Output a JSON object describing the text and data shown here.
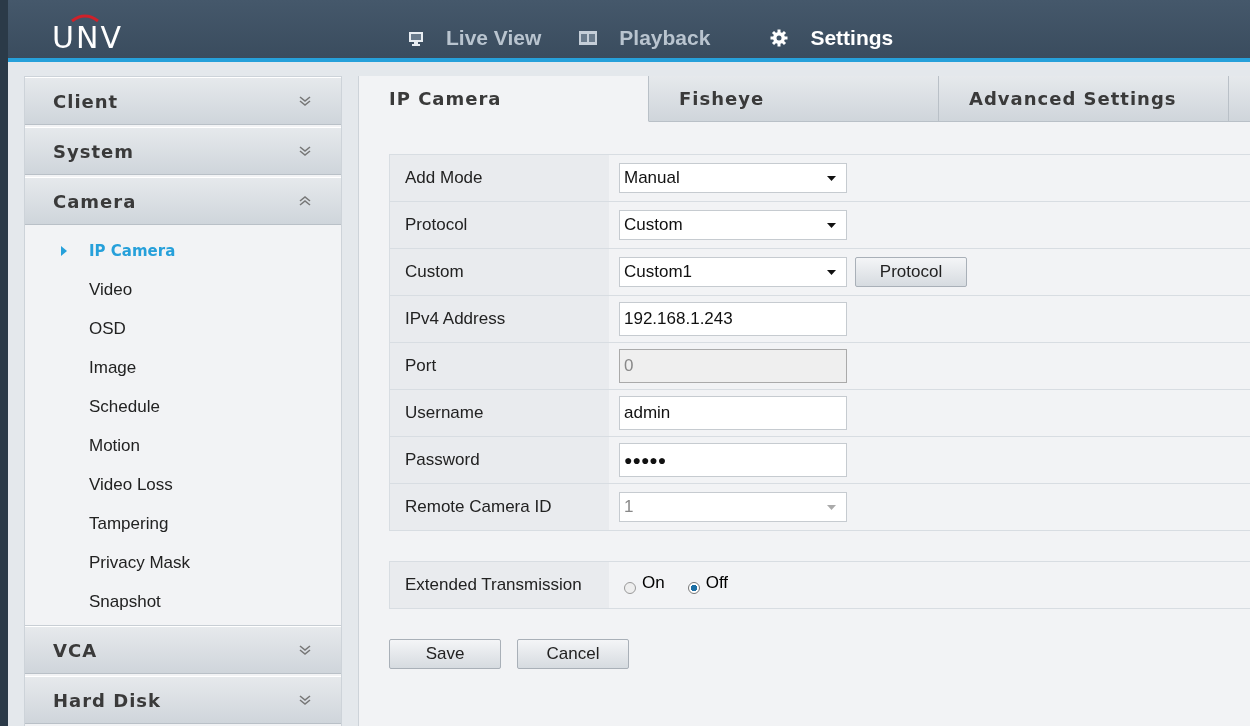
{
  "header": {
    "logo": "UNV",
    "nav": [
      {
        "label": "Live View",
        "selected": false
      },
      {
        "label": "Playback",
        "selected": false
      },
      {
        "label": "Settings",
        "selected": true
      }
    ]
  },
  "sidebar": {
    "groups": [
      {
        "label": "Client",
        "expanded": false
      },
      {
        "label": "System",
        "expanded": false
      },
      {
        "label": "Camera",
        "expanded": true,
        "items": [
          {
            "label": "IP Camera",
            "selected": true
          },
          {
            "label": "Video",
            "selected": false
          },
          {
            "label": "OSD",
            "selected": false
          },
          {
            "label": "Image",
            "selected": false
          },
          {
            "label": "Schedule",
            "selected": false
          },
          {
            "label": "Motion",
            "selected": false
          },
          {
            "label": "Video Loss",
            "selected": false
          },
          {
            "label": "Tampering",
            "selected": false
          },
          {
            "label": "Privacy Mask",
            "selected": false
          },
          {
            "label": "Snapshot",
            "selected": false
          }
        ]
      },
      {
        "label": "VCA",
        "expanded": false
      },
      {
        "label": "Hard Disk",
        "expanded": false
      }
    ]
  },
  "tabs": [
    {
      "label": "IP Camera",
      "selected": true
    },
    {
      "label": "Fisheye",
      "selected": false
    },
    {
      "label": "Advanced Settings",
      "selected": false
    }
  ],
  "form": [
    {
      "label": "Add Mode",
      "kind": "select",
      "value": "Manual",
      "disabled": false
    },
    {
      "label": "Protocol",
      "kind": "select",
      "value": "Custom",
      "disabled": false
    },
    {
      "label": "Custom",
      "kind": "select",
      "value": "Custom1",
      "disabled": false,
      "button": "Protocol"
    },
    {
      "label": "IPv4 Address",
      "kind": "text",
      "value": "192.168.1.243",
      "disabled": false
    },
    {
      "label": "Port",
      "kind": "text",
      "value": "0",
      "disabled": true
    },
    {
      "label": "Username",
      "kind": "text",
      "value": "admin",
      "disabled": false
    },
    {
      "label": "Password",
      "kind": "password",
      "value": "●●●●●",
      "disabled": false
    },
    {
      "label": "Remote Camera ID",
      "kind": "select",
      "value": "1",
      "disabled": true
    }
  ],
  "extended": {
    "label": "Extended Transmission",
    "options": [
      {
        "label": "On",
        "selected": false
      },
      {
        "label": "Off",
        "selected": true
      }
    ]
  },
  "buttons": [
    "Save",
    "Cancel"
  ]
}
